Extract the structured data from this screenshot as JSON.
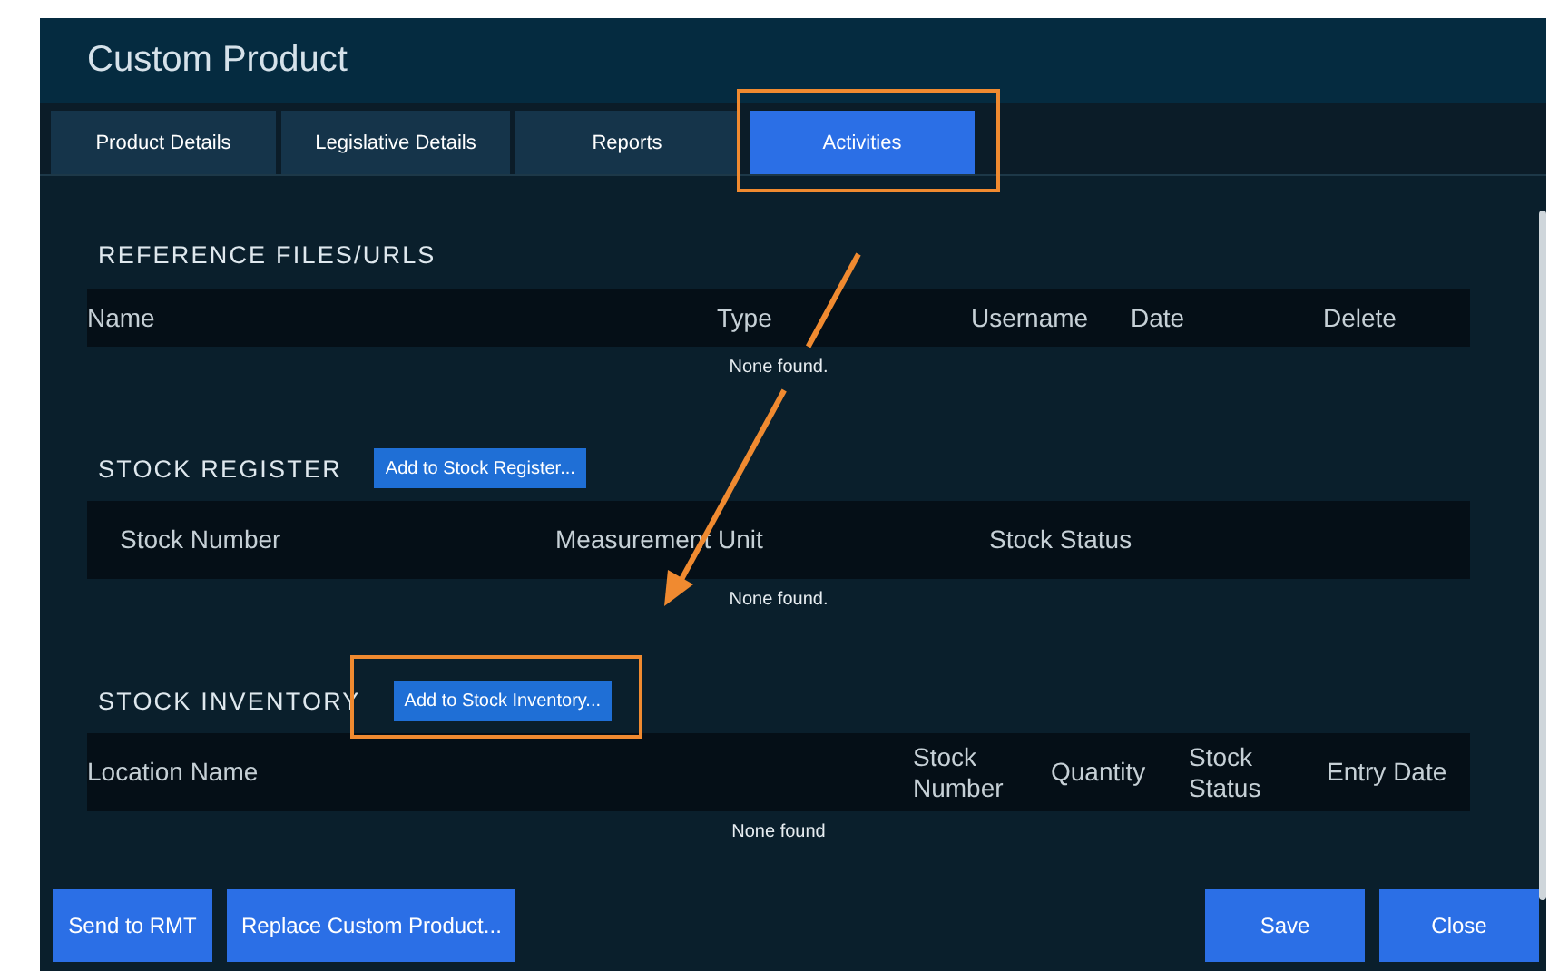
{
  "window": {
    "title": "Custom Product"
  },
  "tabs": [
    {
      "label": "Product Details",
      "selected": false,
      "highlighted": false
    },
    {
      "label": "Legislative Details",
      "selected": false,
      "highlighted": false
    },
    {
      "label": "Reports",
      "selected": false,
      "highlighted": false
    },
    {
      "label": "Activities",
      "selected": true,
      "highlighted": true
    }
  ],
  "sections": [
    {
      "title": "REFERENCE FILES/URLS",
      "columns": [
        "Name",
        "Type",
        "Username",
        "Date",
        "Delete"
      ],
      "empty_text": "None found."
    },
    {
      "title": "STOCK REGISTER",
      "button": {
        "label": "Add to Stock Register...",
        "highlighted": false
      },
      "columns": [
        "Stock Number",
        "Measurement Unit",
        "Stock Status"
      ],
      "empty_text": "None found."
    },
    {
      "title": "STOCK INVENTORY",
      "button": {
        "label": "Add to Stock Inventory...",
        "highlighted": true
      },
      "columns": [
        "Location Name",
        "Stock Number",
        "Quantity",
        "Stock Status",
        "Entry Date"
      ],
      "empty_text": "None found"
    }
  ],
  "footer": {
    "left_buttons": [
      "Send to RMT",
      "Replace Custom Product..."
    ],
    "right_buttons": [
      "Save",
      "Close"
    ]
  }
}
